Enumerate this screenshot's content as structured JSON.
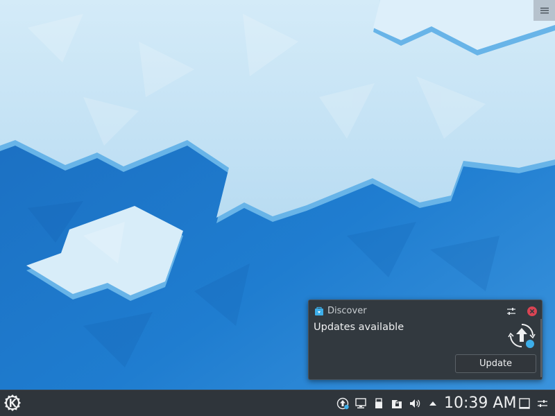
{
  "notification": {
    "app_name": "Discover",
    "summary": "Updates available",
    "action_label": "Update",
    "app_icon": "discover-bag-icon",
    "image_icon": "update-arrow-icon"
  },
  "panel": {
    "clock": "10:39 AM",
    "launcher_icon": "kde-logo-icon",
    "tray_icons": [
      "updates-icon",
      "network-icon",
      "usb-device-icon",
      "vault-icon",
      "volume-icon",
      "expand-arrow-icon",
      "show-desktop-icon",
      "panel-settings-icon"
    ]
  },
  "desktop": {
    "toolbox_icon": "hamburger-menu-icon"
  },
  "colors": {
    "panel_bg": "#2f353b",
    "notification_bg": "#32393f",
    "wallpaper_blue": "#1d78c8",
    "wallpaper_ice": "#cfe8f7",
    "accent": "#3daee9",
    "close_red": "#da4453"
  }
}
